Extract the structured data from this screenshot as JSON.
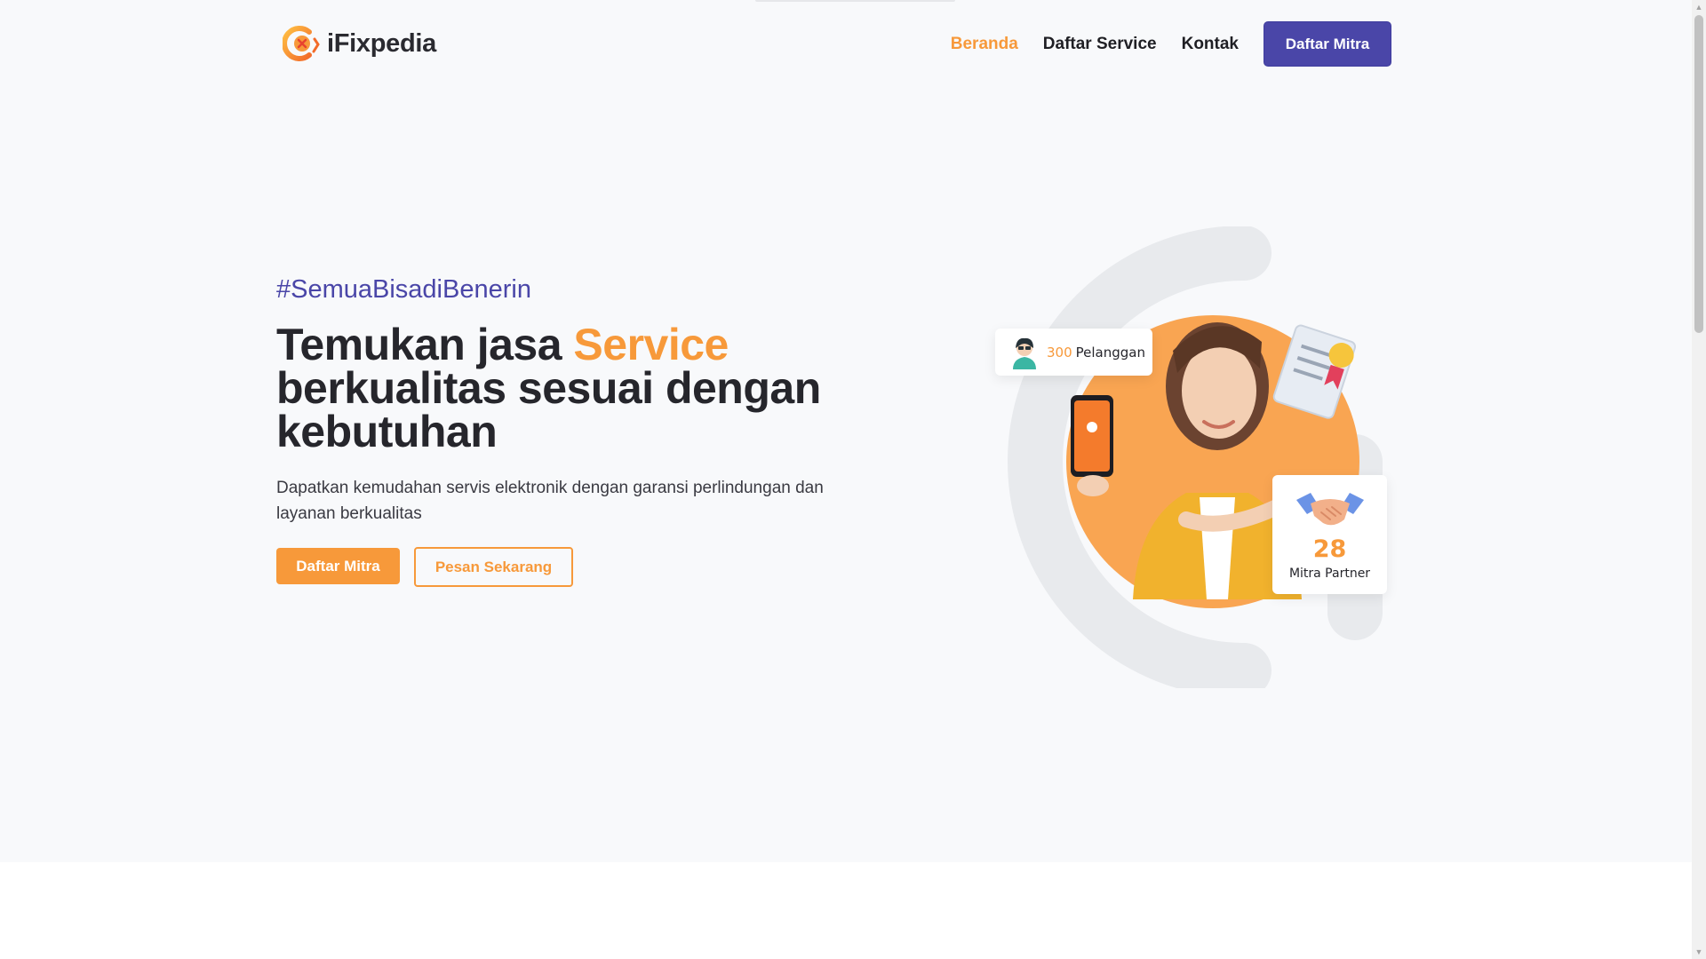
{
  "brand": {
    "name": "iFixpedia",
    "color_primary": "#4a46a8",
    "color_accent": "#f7993a"
  },
  "nav": {
    "links": [
      {
        "label": "Beranda",
        "active": true
      },
      {
        "label": "Daftar Service",
        "active": false
      },
      {
        "label": "Kontak",
        "active": false
      }
    ],
    "cta_label": "Daftar Mitra"
  },
  "hero": {
    "tagline": "#SemuaBisadiBenerin",
    "headline_before": "Temukan jasa ",
    "headline_accent": "Service",
    "headline_after": " berkualitas sesuai dengan kebutuhan",
    "description": "Dapatkan kemudahan servis elektronik dengan garansi perlindungan dan layanan berkualitas",
    "primary_button": "Daftar Mitra",
    "secondary_button": "Pesan Sekarang"
  },
  "stats": {
    "customers": {
      "count": "300",
      "label": "Pelanggan"
    },
    "partners": {
      "count": "28",
      "label": "Mitra Partner"
    }
  },
  "icons": {
    "logo": "ifixpedia-logo-icon",
    "customer_avatar": "customer-avatar-icon",
    "handshake": "handshake-icon",
    "certificate": "certificate-icon"
  }
}
